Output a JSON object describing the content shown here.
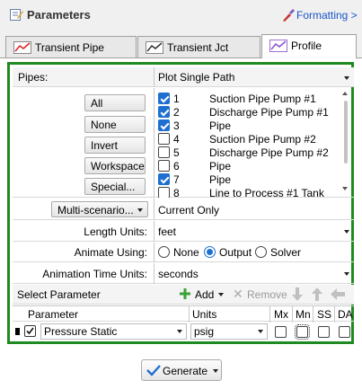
{
  "title": "Parameters",
  "formatting": "Formatting >",
  "tabs": [
    {
      "label": "Transient Pipe",
      "active": false
    },
    {
      "label": "Transient Jct",
      "active": false
    },
    {
      "label": "Profile",
      "active": true
    }
  ],
  "pipes": {
    "label": "Pipes:",
    "mode_value": "Plot Single Path",
    "buttons": [
      "All",
      "None",
      "Invert",
      "Workspace",
      "Special..."
    ],
    "items": [
      {
        "num": "1",
        "name": "Suction Pipe Pump #1",
        "checked": true
      },
      {
        "num": "2",
        "name": "Discharge Pipe Pump #1",
        "checked": true
      },
      {
        "num": "3",
        "name": "Pipe",
        "checked": true
      },
      {
        "num": "4",
        "name": "Suction Pipe Pump #2",
        "checked": false
      },
      {
        "num": "5",
        "name": "Discharge Pipe Pump #2",
        "checked": false
      },
      {
        "num": "6",
        "name": "Pipe",
        "checked": false
      },
      {
        "num": "7",
        "name": "Pipe",
        "checked": true
      },
      {
        "num": "8",
        "name": "Line to Process #1 Tank",
        "checked": false
      }
    ]
  },
  "scenario": {
    "button": "Multi-scenario...",
    "value": "Current Only"
  },
  "length_units": {
    "label": "Length Units:",
    "value": "feet"
  },
  "animate": {
    "label": "Animate Using:",
    "options": [
      "None",
      "Output",
      "Solver"
    ],
    "selected": "Output"
  },
  "anim_time_units": {
    "label": "Animation Time Units:",
    "value": "seconds"
  },
  "toolbar": {
    "select_label": "Select Parameter",
    "add": "Add",
    "remove": "Remove"
  },
  "grid": {
    "headers": {
      "parameter": "Parameter",
      "units": "Units",
      "mx": "Mx",
      "mn": "Mn",
      "ss": "SS",
      "da": "DA"
    },
    "rows": [
      {
        "parameter": "Pressure Static",
        "units": "psig",
        "checked": true
      }
    ]
  },
  "generate": "Generate",
  "colors": {
    "accent_green": "#1f8a1f",
    "link_blue": "#1a55c8",
    "check_blue": "#1e6fd0",
    "add_green": "#3aa335"
  }
}
